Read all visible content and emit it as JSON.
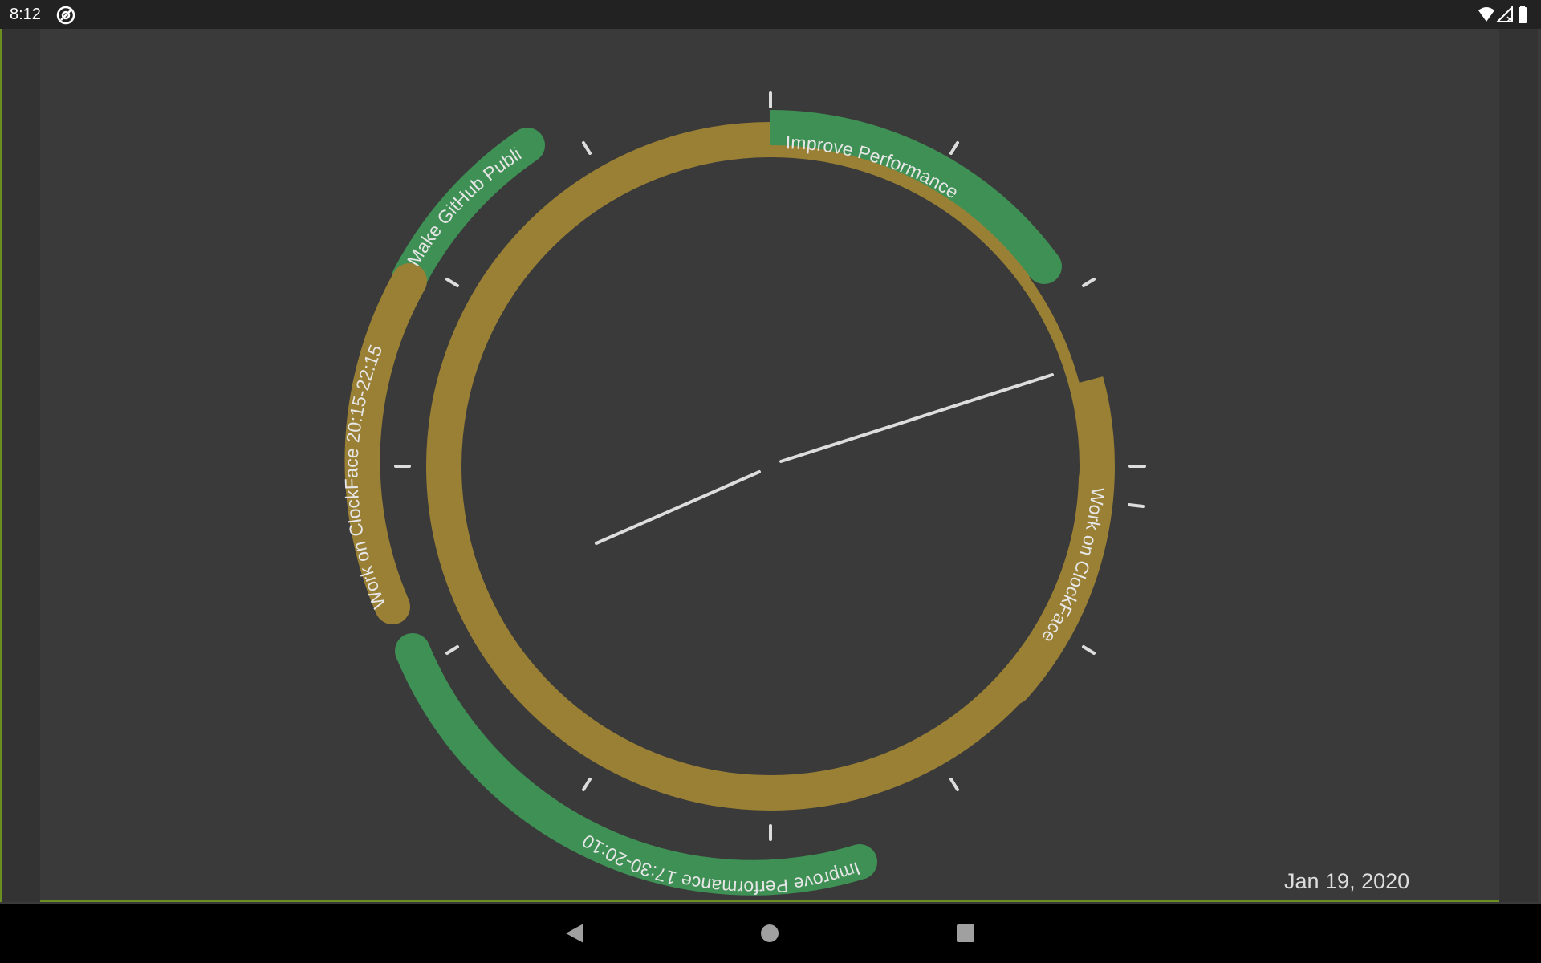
{
  "status_bar": {
    "time": "8:12",
    "icons": [
      "app-icon",
      "wifi-icon",
      "signal-icon",
      "battery-icon"
    ]
  },
  "clock": {
    "hour_hand_color": "#dddddd",
    "tick_color": "#dddddd",
    "inner_ring_color": "#9a8035",
    "task_colors": {
      "green": "#3f9055",
      "gold": "#9a8035"
    },
    "tasks": [
      {
        "label": "Improve Performance",
        "color": "green"
      },
      {
        "label": "Make GitHub Publi...",
        "color": "green"
      },
      {
        "label": "Work on ClockFace  20:15-22:15",
        "color": "gold"
      },
      {
        "label": "Improve Performance  17:30-20:10",
        "color": "green"
      },
      {
        "label": "Work on ClockFace",
        "color": "gold"
      }
    ]
  },
  "date": "Jan 19, 2020",
  "navigation": {
    "back": "back-icon",
    "home": "home-icon",
    "recents": "recents-icon"
  }
}
